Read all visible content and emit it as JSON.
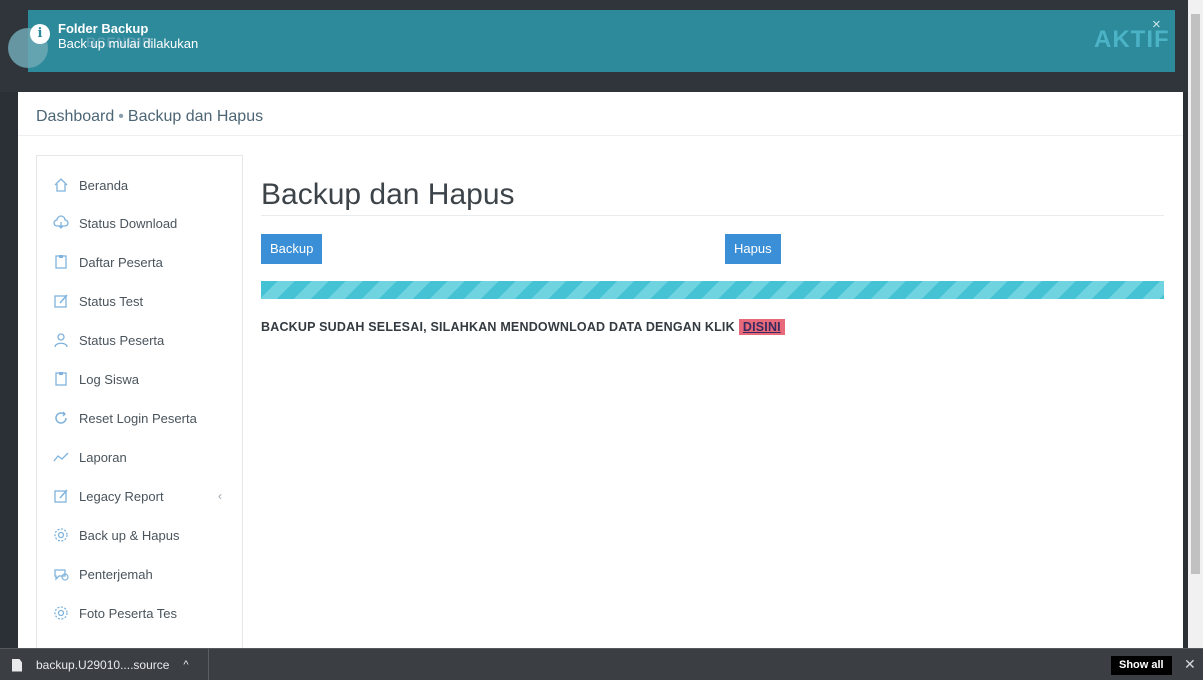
{
  "notification": {
    "title": "Folder Backup",
    "message": "Back up mulai dilakukan",
    "close_glyph": "×",
    "logo_text": "BSENDIR",
    "status_text": "AKTIF",
    "info_glyph": "i"
  },
  "breadcrumb": {
    "items": [
      "Dashboard",
      "Backup dan Hapus"
    ],
    "separator": "•"
  },
  "sidebar": {
    "items": [
      {
        "label": "Beranda",
        "icon": "home-icon"
      },
      {
        "label": "Status Download",
        "icon": "cloud-download-icon"
      },
      {
        "label": "Daftar Peserta",
        "icon": "clipboard-icon"
      },
      {
        "label": "Status Test",
        "icon": "edit-icon"
      },
      {
        "label": "Status Peserta",
        "icon": "user-icon"
      },
      {
        "label": "Log Siswa",
        "icon": "clipboard-icon"
      },
      {
        "label": "Reset Login Peserta",
        "icon": "refresh-icon"
      },
      {
        "label": "Laporan",
        "icon": "chart-line-icon"
      },
      {
        "label": "Legacy Report",
        "icon": "edit-icon"
      },
      {
        "label": "Back up & Hapus",
        "icon": "gear-icon"
      },
      {
        "label": "Penterjemah",
        "icon": "chat-icon"
      },
      {
        "label": "Foto Peserta Tes",
        "icon": "gear-icon"
      }
    ],
    "legacy_chevron": "‹"
  },
  "content": {
    "title": "Backup dan Hapus",
    "backup_button": "Backup",
    "hapus_button": "Hapus",
    "progress": 1.0,
    "result_text": "BACKUP SUDAH SELESAI, SILAHKAN MENDOWNLOAD DATA DENGAN KLIK",
    "result_link": "DISINI"
  },
  "download_bar": {
    "file_name": "backup.U29010....source",
    "caret": "^",
    "show_all": "Show all",
    "close_glyph": "✕"
  },
  "colors": {
    "header_teal": "#2d8a9b",
    "button_blue": "#3a8fd6",
    "progress_cyan": "#45c2d3",
    "link_highlight": "#e86a7a",
    "icon_blue": "#7fb3dd"
  }
}
